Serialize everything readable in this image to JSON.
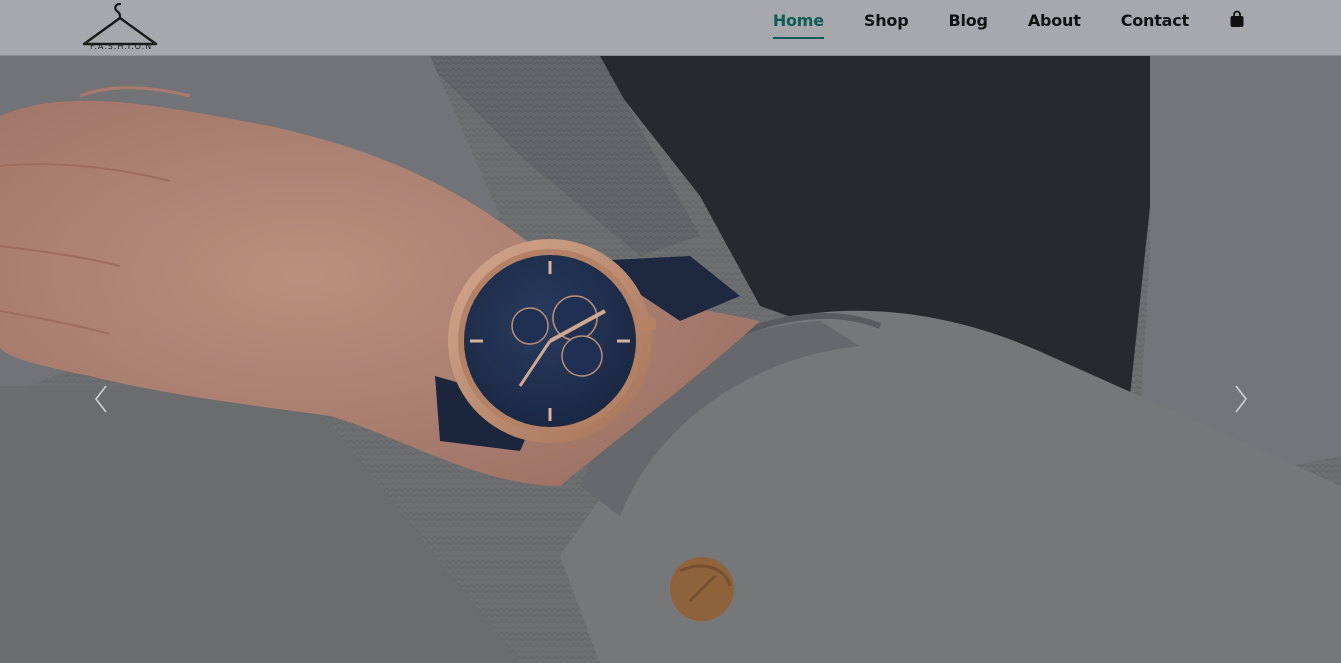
{
  "brand": {
    "logo_text": "F.A.S.H.I.O.N",
    "logo_icon": "hanger-icon"
  },
  "nav": {
    "items": [
      {
        "label": "Home",
        "active": true
      },
      {
        "label": "Shop",
        "active": false
      },
      {
        "label": "Blog",
        "active": false
      },
      {
        "label": "About",
        "active": false
      },
      {
        "label": "Contact",
        "active": false
      }
    ],
    "cart_icon": "shopping-bag-icon"
  },
  "hero": {
    "image": "model-wearing-rose-gold-chronograph-watch-with-blue-mesh-strap",
    "prev_icon": "chevron-left-icon",
    "next_icon": "chevron-right-icon"
  },
  "colors": {
    "header_bg": "#a6a8ad",
    "active_link": "#0d5c56",
    "link": "#121212"
  }
}
